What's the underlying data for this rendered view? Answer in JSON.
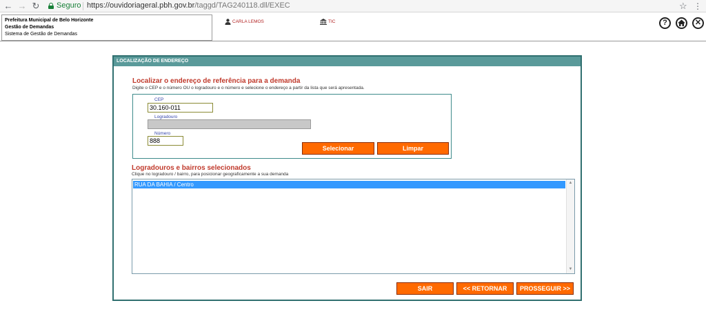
{
  "browser": {
    "secure_label": "Seguro",
    "url_host": "https://ouvidoriageral.pbh.gov.br",
    "url_path": "/taggd/TAG240118.dll/EXEC"
  },
  "header": {
    "org_name": "Prefeitura Municipal de Belo Horizonte",
    "module": "Gestão de Demandas",
    "system": "Sistema de Gestão de Demandas",
    "user_name": "CARLA LEMOS",
    "unit": "TIC"
  },
  "panel": {
    "title": "LOCALIZAÇÃO DE ENDEREÇO",
    "locate_title": "Localizar o endereço de referência para a demanda",
    "locate_instructions": "Digite o CEP e o número OU o logradouro e o número e selecione o endereço a partir da lista que será apresentada.",
    "cep_label": "CEP",
    "cep_value": "30.160-011",
    "logradouro_label": "Logradouro",
    "logradouro_value": "",
    "numero_label": "Número",
    "numero_value": "888",
    "select_button": "Selecionar",
    "clear_button": "Limpar",
    "list_title": "Logradouros e bairros selecionados",
    "list_instructions": "Clique no logradouro / bairro, para posicionar geograficamente a sua demanda",
    "list_items": [
      "RUA DA BAHIA / Centro"
    ],
    "exit_button": "SAIR",
    "back_button": "<< RETORNAR",
    "next_button": "PROSSEGUIR >>"
  },
  "colors": {
    "panel_header": "#5a9a9a",
    "accent_button": "#ff6a00",
    "section_title": "#c0392b",
    "selected_row": "#3399ff"
  }
}
